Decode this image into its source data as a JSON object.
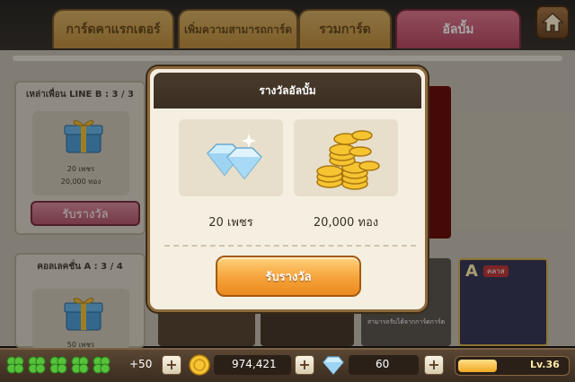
{
  "tabs": [
    {
      "label": "การ์ดคาแรกเตอร์"
    },
    {
      "label": "เพิ่มความสามารถการ์ด"
    },
    {
      "label": "รวมการ์ด"
    },
    {
      "label": "อัลบั้ม"
    }
  ],
  "cards": [
    {
      "title": "เหล่าเพื่อน LINE B : 3 / 3",
      "reward_gems": "20 เพชร",
      "reward_gold": "20,000 ทอง",
      "claim_label": "รับรางวัล"
    },
    {
      "title": "คอลเลคชั่น A : 3 / 4",
      "reward_gems": "50 เพชร"
    }
  ],
  "background_caption": "สามารถรับได้จากการ์ดการ์ด",
  "background_card_tag": "คลาส",
  "background_card_letter": "A",
  "modal": {
    "title": "รางวัลอัลบั้ม",
    "gem_label": "20 เพชร",
    "gold_label": "20,000 ทอง",
    "claim_label": "รับรางวัล"
  },
  "status": {
    "lives_extra": "+50",
    "gold": "974,421",
    "gems": "60",
    "level": "Lv.36",
    "level_progress": 0.36
  },
  "icons": {
    "home": "home-icon",
    "gift": "gift-box-icon",
    "diamond": "diamond-icon",
    "coins": "gold-coins-icon",
    "clover": "clover-icon"
  },
  "colors": {
    "active_tab": "#b84a62",
    "inactive_tab": "#c08f3f",
    "claim_button": "#f6a23a"
  }
}
